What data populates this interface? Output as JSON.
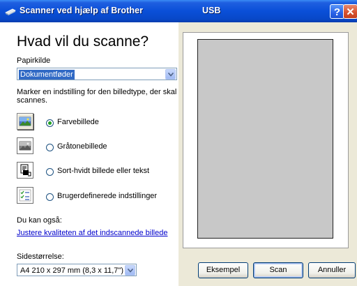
{
  "window": {
    "title": "Scanner ved hjælp af Brother",
    "connection": "USB",
    "help_button": "?",
    "close_button": "✕"
  },
  "left": {
    "heading": "Hvad vil du scanne?",
    "paper_source_label": "Papirkilde",
    "paper_source_value": "Dokumentføder",
    "instruction": "Marker en indstilling for den billedtype, der skal scannes.",
    "options": [
      {
        "label": "Farvebillede",
        "checked": true,
        "icon": "color-photo-icon"
      },
      {
        "label": "Gråtonebillede",
        "checked": false,
        "icon": "grayscale-photo-icon"
      },
      {
        "label": "Sort-hvidt billede eller tekst",
        "checked": false,
        "icon": "bw-text-icon"
      },
      {
        "label": "Brugerdefinerede indstillinger",
        "checked": false,
        "icon": "custom-settings-icon"
      }
    ],
    "also_label": "Du kan også:",
    "adjust_link": "Justere kvaliteten af det indscannede billede",
    "page_size_label": "Sidestørrelse:",
    "page_size_value": "A4 210 x 297 mm (8,3 x 11,7\")"
  },
  "buttons": {
    "preview": "Eksempel",
    "scan": "Scan",
    "cancel": "Annuller"
  },
  "colors": {
    "titlebar": "#0a4fd8",
    "selection": "#316ac5",
    "link": "#0000cc",
    "preview_area": "#c8c8c8"
  }
}
